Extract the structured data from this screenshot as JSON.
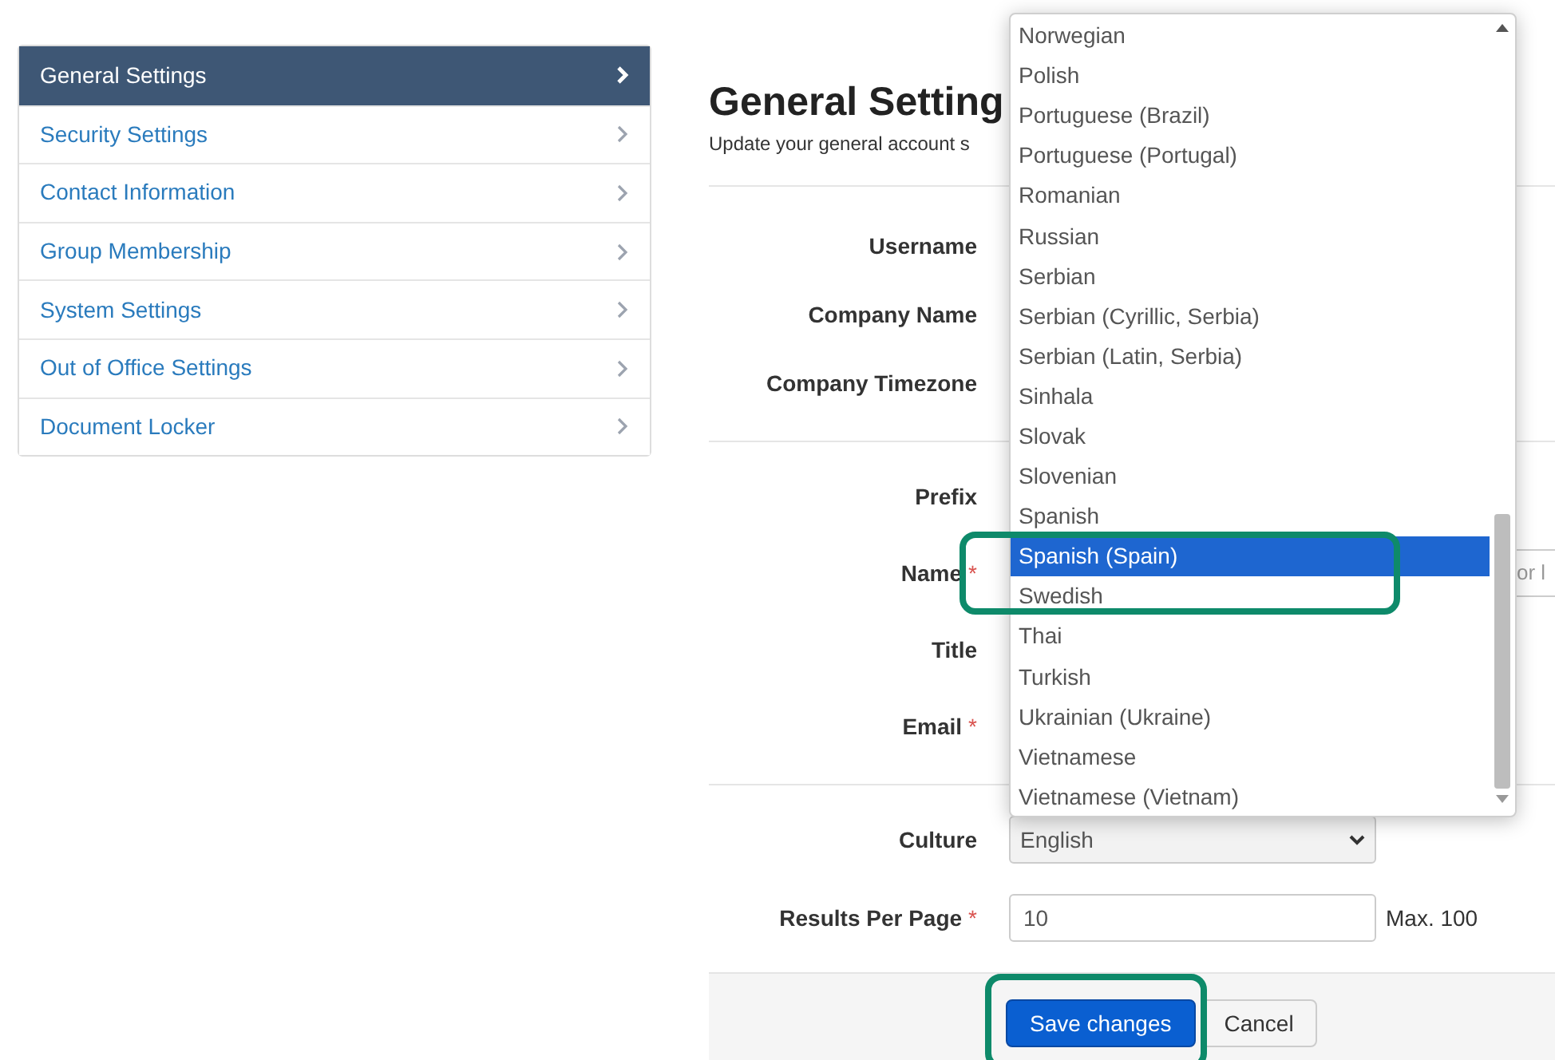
{
  "sidebar": {
    "items": [
      {
        "label": "General Settings",
        "selected": true
      },
      {
        "label": "Security Settings",
        "selected": false
      },
      {
        "label": "Contact Information",
        "selected": false
      },
      {
        "label": "Group Membership",
        "selected": false
      },
      {
        "label": "System Settings",
        "selected": false
      },
      {
        "label": "Out of Office Settings",
        "selected": false
      },
      {
        "label": "Document Locker",
        "selected": false
      }
    ]
  },
  "heading": "General Setting",
  "subtitle": "Update your general account s",
  "sections": [
    {
      "rows": [
        {
          "label": "Username",
          "required": false
        },
        {
          "label": "Company Name",
          "required": false
        },
        {
          "label": "Company Timezone",
          "required": false
        }
      ]
    },
    {
      "rows": [
        {
          "label": "Prefix",
          "required": false
        },
        {
          "label": "Name",
          "required": true,
          "field_fragment": "or l"
        },
        {
          "label": "Title",
          "required": false
        },
        {
          "label": "Email",
          "required": true
        }
      ]
    }
  ],
  "culture": {
    "label": "Culture",
    "value": "English"
  },
  "results_per_page": {
    "label": "Results Per Page",
    "required": true,
    "value": "10",
    "hint": "Max. 100"
  },
  "required_mark": "*",
  "dropdown": {
    "options": [
      {
        "label": "Norwegian",
        "selected": false
      },
      {
        "label": "Polish",
        "selected": false
      },
      {
        "label": "Portuguese (Brazil)",
        "selected": false
      },
      {
        "label": "Portuguese (Portugal)",
        "selected": false
      },
      {
        "label": "Romanian",
        "selected": false
      },
      {
        "label": "Russian",
        "selected": false
      },
      {
        "label": "Serbian",
        "selected": false
      },
      {
        "label": "Serbian (Cyrillic, Serbia)",
        "selected": false
      },
      {
        "label": "Serbian (Latin, Serbia)",
        "selected": false
      },
      {
        "label": "Sinhala",
        "selected": false
      },
      {
        "label": "Slovak",
        "selected": false
      },
      {
        "label": "Slovenian",
        "selected": false
      },
      {
        "label": "Spanish",
        "selected": false
      },
      {
        "label": "Spanish (Spain)",
        "selected": true
      },
      {
        "label": "Swedish",
        "selected": false
      },
      {
        "label": "Thai",
        "selected": false
      },
      {
        "label": "Turkish",
        "selected": false
      },
      {
        "label": "Ukrainian (Ukraine)",
        "selected": false
      },
      {
        "label": "Vietnamese",
        "selected": false
      },
      {
        "label": "Vietnamese (Vietnam)",
        "selected": false
      }
    ]
  },
  "buttons": [
    {
      "label": "Save changes",
      "kind": "primary"
    },
    {
      "label": "Cancel",
      "kind": "default"
    }
  ]
}
